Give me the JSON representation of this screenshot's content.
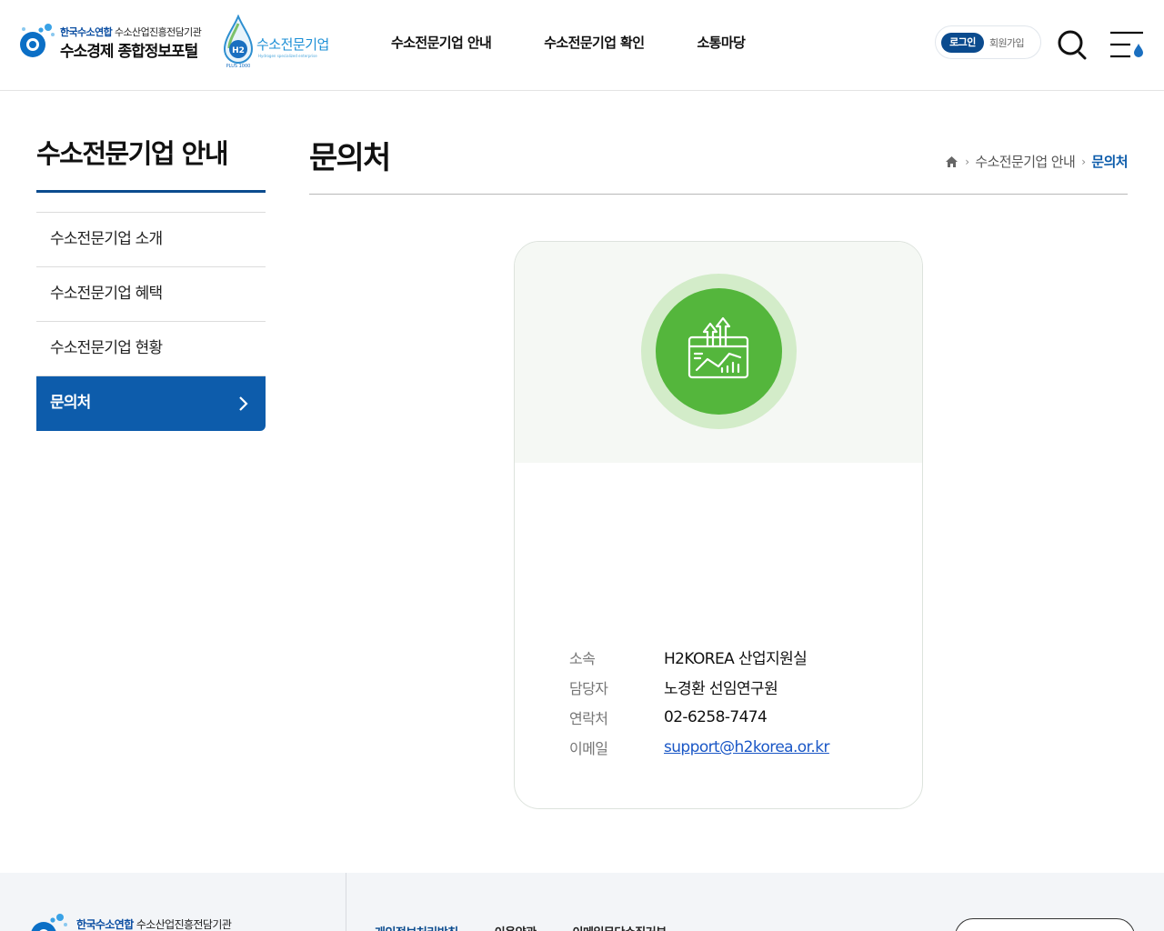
{
  "header": {
    "logo_sub_accent": "한국수소연합",
    "logo_sub": " 수소산업진흥전담기관",
    "logo_title": "수소경제 종합정보포털",
    "logo2_title": "수소전문기업",
    "logo2_sub": "Hydrogen specialized  enterprise",
    "logo2_badge": "H2",
    "logo2_badge_sub": "PLUS 1000",
    "nav": [
      "수소전문기업 안내",
      "수소전문기업 확인",
      "소통마당"
    ],
    "login_label": "로그인",
    "join_label": "회원가입"
  },
  "sidebar": {
    "title": "수소전문기업 안내",
    "items": [
      {
        "label": "수소전문기업 소개"
      },
      {
        "label": "수소전문기업 혜택"
      },
      {
        "label": "수소전문기업 현황"
      },
      {
        "label": "문의처"
      }
    ],
    "active_index": 3
  },
  "main": {
    "page_title": "문의처",
    "breadcrumb": [
      "수소전문기업 안내",
      "문의처"
    ]
  },
  "contact": {
    "rows": [
      {
        "key": "소속",
        "value": "H2KOREA 산업지원실"
      },
      {
        "key": "담당자",
        "value": "노경환 선임연구원"
      },
      {
        "key": "연락처",
        "value": "02-6258-7474"
      },
      {
        "key": "이메일",
        "value": "support@h2korea.or.kr"
      }
    ]
  },
  "footer": {
    "logo_sub_accent": "한국수소연합",
    "logo_sub": " 수소산업진흥전담기관",
    "links": [
      "개인정보처리방침",
      "이용약관",
      "이메일무단수집거부"
    ]
  },
  "colors": {
    "primary": "#0b4b8e",
    "active_menu": "#0d5cab",
    "icon_green": "#54b63c",
    "icon_ring": "#d3ecc9",
    "link_blue": "#1a57c6"
  },
  "icons": {
    "header_logo": "hydrogen-portal-logo-icon",
    "header_logo2": "h2-droplet-logo-icon",
    "search": "search-icon",
    "menu": "menu-icon",
    "home": "home-icon",
    "chevron": "chevron-right-icon",
    "contact_illustration": "growth-chart-icon"
  }
}
